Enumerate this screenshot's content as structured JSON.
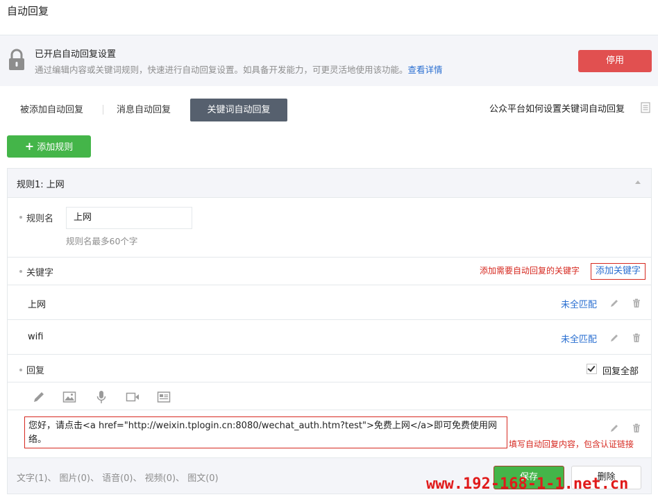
{
  "header": {
    "title": "自动回复"
  },
  "status": {
    "title": "已开启自动回复设置",
    "description": "通过编辑内容或关键词规则，快速进行自动回复设置。如具备开发能力，可更灵活地使用该功能。",
    "details_link": "查看详情",
    "disable_button": "停用"
  },
  "tabs": [
    {
      "label": "被添加自动回复",
      "active": false
    },
    {
      "label": "消息自动回复",
      "active": false
    },
    {
      "label": "关键词自动回复",
      "active": true
    }
  ],
  "help_link": "公众平台如何设置关键词自动回复",
  "add_rule_button": "添加规则",
  "rule": {
    "header": "规则1: 上网",
    "name_label": "规则名",
    "name_value": "上网",
    "name_hint": "规则名最多60个字",
    "keyword_label": "关键字",
    "keyword_annotation": "添加需要自动回复的关键字",
    "add_keyword_link": "添加关键字",
    "keywords": [
      {
        "text": "上网",
        "match": "未全匹配"
      },
      {
        "text": "wifi",
        "match": "未全匹配"
      }
    ],
    "reply_label": "回复",
    "reply_all_label": "回复全部",
    "reply_all_checked": true,
    "media_icons": [
      "pencil-icon",
      "image-icon",
      "microphone-icon",
      "video-icon",
      "news-icon"
    ],
    "reply_text": "您好，请点击<a href=\"http://weixin.tplogin.cn:8080/wechat_auth.htm?test\">免费上网</a>即可免费使用网络。",
    "reply_annotation": "填写自动回复内容，包含认证链接",
    "footer_stats": "文字(1)、 图片(0)、 语音(0)、 视频(0)、 图文(0)",
    "save_button": "保存",
    "delete_button": "删除"
  },
  "watermark": "www.192-168-1-1.net.cn",
  "colors": {
    "accent_green": "#44b549",
    "danger_red": "#e15050",
    "link_blue": "#2a6fd1",
    "annotation_red": "#d6281f",
    "tab_active_bg": "#56606e"
  }
}
